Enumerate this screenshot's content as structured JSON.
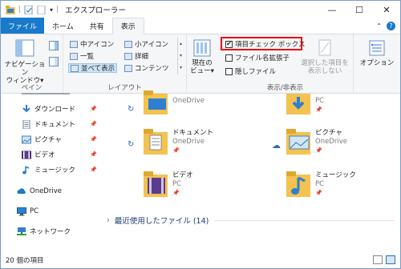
{
  "window": {
    "title": "エクスプローラー"
  },
  "tabs": {
    "file": "ファイル",
    "home": "ホーム",
    "share": "共有",
    "view": "表示"
  },
  "ribbon": {
    "pane": {
      "nav_pane_line1": "ナビゲーション",
      "nav_pane_line2": "ウィンドウ▾",
      "label": "ペイン"
    },
    "layout": {
      "items": [
        "中アイコン",
        "小アイコン",
        "一覧",
        "詳細",
        "並べて表示",
        "コンテンツ"
      ],
      "label": "レイアウト"
    },
    "current_view": {
      "line1": "現在の",
      "line2": "ビュー▾"
    },
    "show_hide": {
      "item_checkboxes": "項目チェック ボックス",
      "file_extensions": "ファイル名拡張子",
      "hidden_items": "隠しファイル",
      "hide_selected_line1": "選択した項目を",
      "hide_selected_line2": "表示しない",
      "label": "表示/非表示"
    },
    "options": "オプション"
  },
  "nav": {
    "items": [
      {
        "label": "ダウンロード",
        "pinned": true
      },
      {
        "label": "ドキュメント",
        "pinned": true
      },
      {
        "label": "ピクチャ",
        "pinned": true
      },
      {
        "label": "ビデオ",
        "pinned": true
      },
      {
        "label": "ミュージック",
        "pinned": true
      },
      {
        "label": "OneDrive",
        "pinned": false
      },
      {
        "label": "PC",
        "pinned": false
      },
      {
        "label": "ネットワーク",
        "pinned": false
      }
    ]
  },
  "content": {
    "tiles": [
      {
        "name": "",
        "location": "OneDrive"
      },
      {
        "name": "",
        "location": "PC"
      },
      {
        "name": "ドキュメント",
        "location": "OneDrive"
      },
      {
        "name": "ピクチャ",
        "location": "OneDrive"
      },
      {
        "name": "ビデオ",
        "location": "PC"
      },
      {
        "name": "ミュージック",
        "location": "PC"
      }
    ],
    "recent": "最近使用したファイル (14)"
  },
  "status": {
    "item_count": "20 個の項目"
  },
  "colors": {
    "accent": "#1979ca",
    "highlight_box": "#e60012",
    "folder": "#f3c24f"
  }
}
